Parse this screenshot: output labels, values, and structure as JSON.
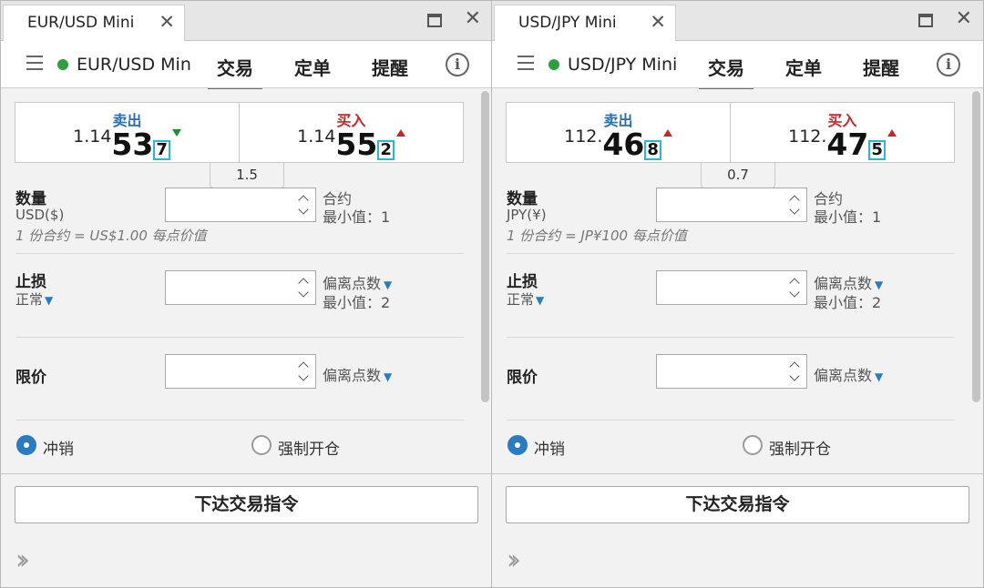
{
  "panels": [
    {
      "tab_title": "EUR/USD Mini",
      "instrument": "EUR/USD Min",
      "nav_tabs": [
        "交易",
        "定单",
        "提醒"
      ],
      "sell": {
        "label": "卖出",
        "prefix": "1.14",
        "big": "53",
        "pip": "7"
      },
      "buy": {
        "label": "买入",
        "prefix": "1.14",
        "big": "55",
        "pip": "2"
      },
      "spread": "1.5",
      "quantity": {
        "label": "数量",
        "unit": "USD($)",
        "side1": "合约",
        "side2": "最小值：1",
        "note": "1 份合约 = US$1.00 每点价值"
      },
      "stop": {
        "label": "止损",
        "mode": "正常",
        "side1": "偏离点数",
        "side2": "最小值：2"
      },
      "limit": {
        "label": "限价",
        "side1": "偏离点数"
      },
      "radio": {
        "opt1": "冲销",
        "opt2": "强制开仓"
      },
      "submit": "下达交易指令"
    },
    {
      "tab_title": "USD/JPY Mini",
      "instrument": "USD/JPY Mini",
      "nav_tabs": [
        "交易",
        "定单",
        "提醒"
      ],
      "sell": {
        "label": "卖出",
        "prefix": "112.",
        "big": "46",
        "pip": "8"
      },
      "buy": {
        "label": "买入",
        "prefix": "112.",
        "big": "47",
        "pip": "5"
      },
      "spread": "0.7",
      "quantity": {
        "label": "数量",
        "unit": "JPY(¥)",
        "side1": "合约",
        "side2": "最小值：1",
        "note": "1 份合约 = JP¥100 每点价值"
      },
      "stop": {
        "label": "止损",
        "mode": "正常",
        "side1": "偏离点数",
        "side2": "最小值：2"
      },
      "limit": {
        "label": "限价",
        "side1": "偏离点数"
      },
      "radio": {
        "opt1": "冲销",
        "opt2": "强制开仓"
      },
      "submit": "下达交易指令"
    }
  ],
  "colors": {
    "accent": "#2a7bc0",
    "sell": "#2a6fad",
    "buy": "#c62828",
    "status": "#2e9e3e",
    "pip_border": "#2bb5d6"
  },
  "icons": {
    "hamburger": "hamburger-icon",
    "info": "info-icon",
    "expand": "double-chevron-right-icon",
    "close": "close-icon",
    "maximize": "maximize-icon"
  }
}
